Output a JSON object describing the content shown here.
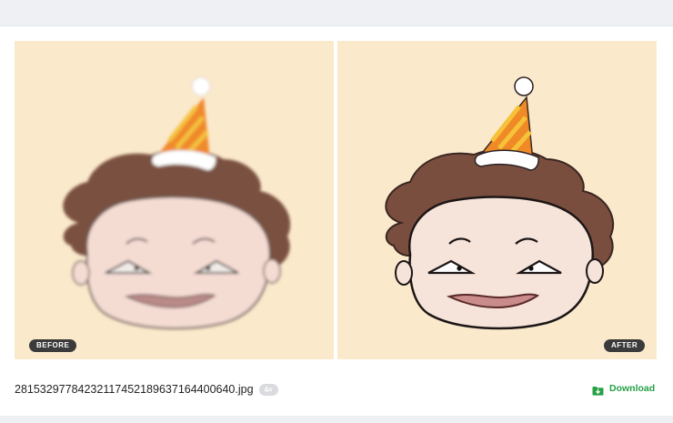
{
  "comparison": {
    "before_label": "BEFORE",
    "after_label": "AFTER"
  },
  "file": {
    "name": "281532977842321174521896371644006​40.jpg",
    "scale_badge": "4×"
  },
  "actions": {
    "download_label": "Download"
  },
  "colors": {
    "accent": "#27a046",
    "panel_background": "#fbe9cc",
    "pill_background": "#3b3b3b"
  },
  "icons": {
    "download": "folder-download-icon"
  }
}
